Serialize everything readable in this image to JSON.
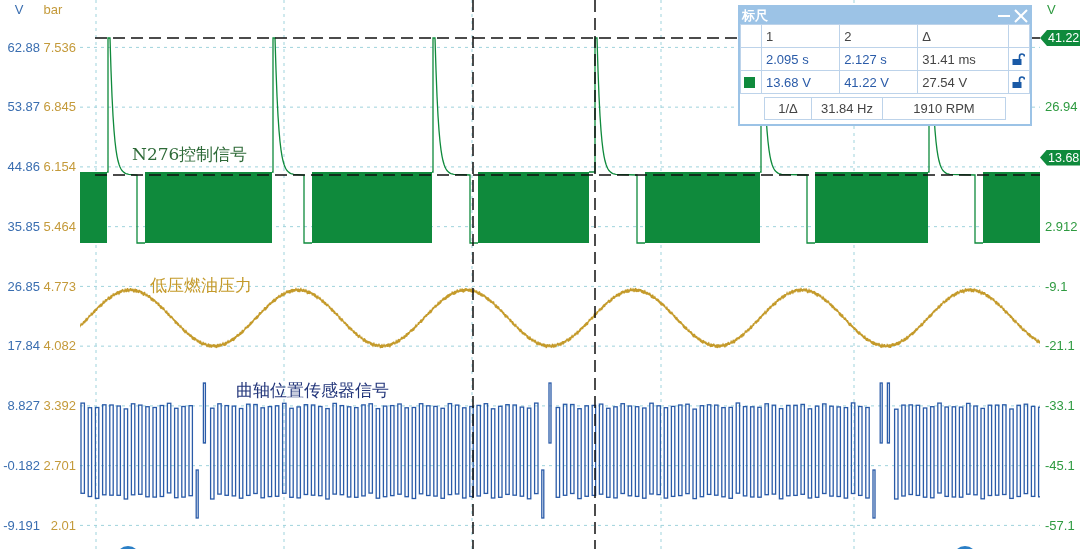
{
  "axis_left": {
    "units": [
      "V",
      "bar"
    ],
    "ticks": [
      {
        "volts": "62.88",
        "bar": "7.536"
      },
      {
        "volts": "53.87",
        "bar": "6.845"
      },
      {
        "volts": "44.86",
        "bar": "6.154"
      },
      {
        "volts": "35.85",
        "bar": "5.464"
      },
      {
        "volts": "26.85",
        "bar": "4.773"
      },
      {
        "volts": "17.84",
        "bar": "4.082"
      },
      {
        "volts": "8.827",
        "bar": "3.392"
      },
      {
        "volts": "-0.182",
        "bar": "2.701"
      },
      {
        "volts": "-9.191",
        "bar": "2.01"
      }
    ]
  },
  "axis_right": {
    "unit": "V",
    "rows": [
      {
        "kind": "marker",
        "text": "41.22"
      },
      {
        "kind": "tick",
        "text": "26.94"
      },
      {
        "kind": "marker",
        "text": "13.68"
      },
      {
        "kind": "tick",
        "text": "2.912"
      },
      {
        "kind": "tick",
        "text": "-9.1"
      },
      {
        "kind": "tick",
        "text": "-21.1"
      },
      {
        "kind": "tick",
        "text": "-33.1"
      },
      {
        "kind": "tick",
        "text": "-45.1"
      },
      {
        "kind": "tick",
        "text": "-57.1"
      }
    ]
  },
  "traces": [
    {
      "kind": "pwm",
      "label": "N276控制信号",
      "color": "#0f8a3c"
    },
    {
      "kind": "wave",
      "label": "低压燃油压力",
      "color": "#c49a2a"
    },
    {
      "kind": "square",
      "label": "曲轴位置传感器信号",
      "color": "#2a5ba8"
    }
  ],
  "ruler": {
    "title": "标尺",
    "columns": [
      "1",
      "2",
      "Δ"
    ],
    "rows": [
      {
        "kind": "time",
        "cells": [
          "2.095 s",
          "2.127 s",
          "31.41 ms"
        ],
        "locked": false
      },
      {
        "kind": "channel",
        "color": "#0f8a3c",
        "cells": [
          "13.68 V",
          "41.22 V",
          "27.54 V"
        ],
        "locked": false
      }
    ],
    "frequency": {
      "label": "1/Δ",
      "hz": "31.84 Hz",
      "rpm": "1910 RPM"
    }
  }
}
